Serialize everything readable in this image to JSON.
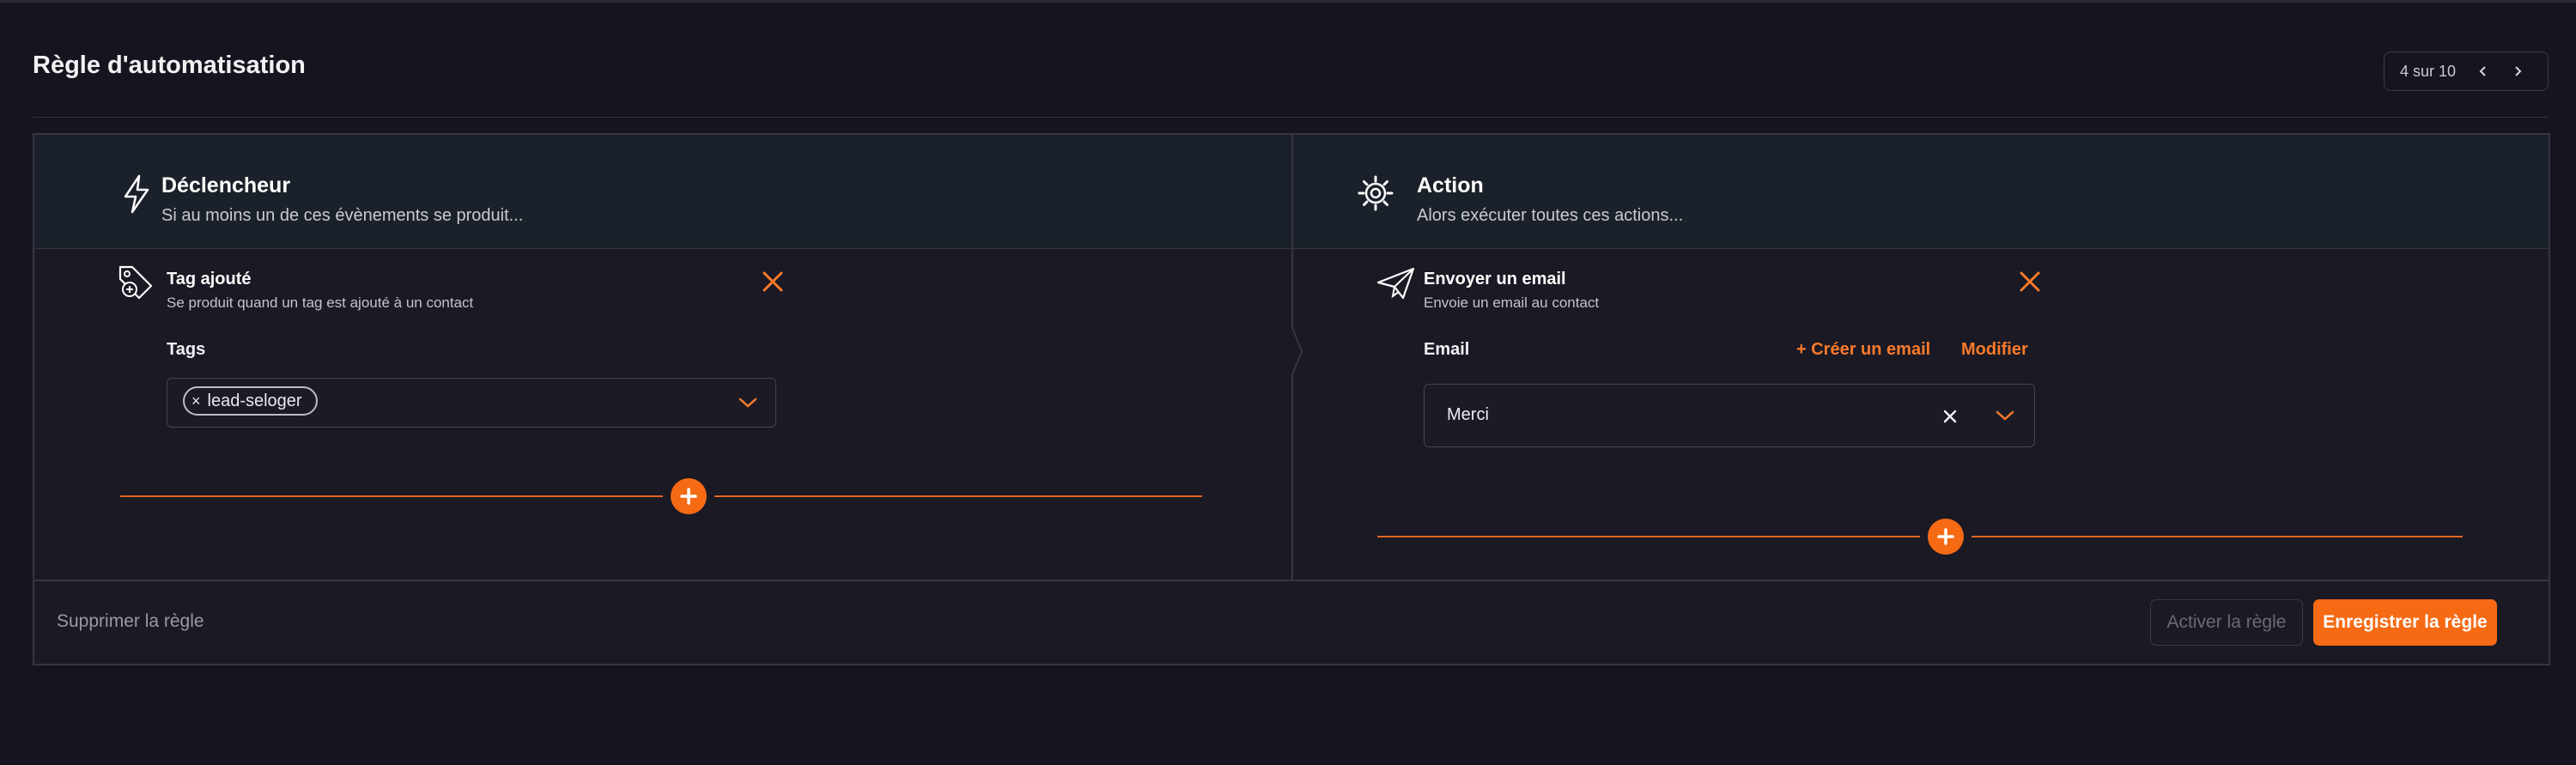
{
  "page": {
    "title": "Règle d'automatisation"
  },
  "pager": {
    "label": "4 sur 10",
    "prev_icon": "chevron-left-icon",
    "next_icon": "chevron-right-icon"
  },
  "trigger": {
    "title": "Déclencheur",
    "subtitle": "Si au moins un de ces évènements se produit...",
    "icon": "lightning-icon",
    "item": {
      "title": "Tag ajouté",
      "subtitle": "Se produit quand un tag est ajouté à un contact",
      "icon": "tags-icon",
      "field_label": "Tags",
      "chips": [
        "lead-seloger"
      ]
    }
  },
  "action": {
    "title": "Action",
    "subtitle": "Alors exécuter toutes ces actions...",
    "icon": "gear-icon",
    "item": {
      "title": "Envoyer un email",
      "subtitle": "Envoie un email au contact",
      "icon": "paper-plane-icon",
      "field_label": "Email",
      "create_link": "+ Créer un email",
      "edit_link": "Modifier",
      "selected_value": "Merci"
    }
  },
  "footer": {
    "delete_label": "Supprimer la règle",
    "activate_label": "Activer la règle",
    "save_label": "Enregistrer la règle"
  },
  "colors": {
    "accent": "#f66a14",
    "background": "#16151f",
    "header_panel": "#1b212a"
  }
}
